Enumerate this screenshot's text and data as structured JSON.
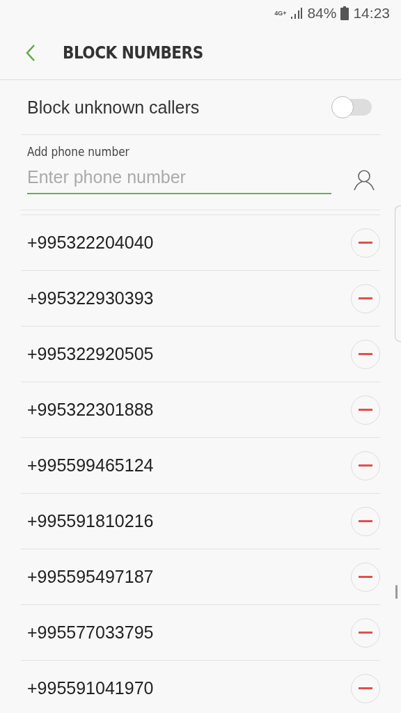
{
  "status_bar": {
    "network": "4G+",
    "battery": "84%",
    "time": "14:23"
  },
  "header": {
    "title": "BLOCK NUMBERS"
  },
  "block_unknown": {
    "label": "Block unknown callers",
    "on": false
  },
  "add_number": {
    "label": "Add phone number",
    "placeholder": "Enter phone number"
  },
  "numbers": [
    {
      "number": "+995322204040"
    },
    {
      "number": "+995322930393"
    },
    {
      "number": "+995322920505"
    },
    {
      "number": "+995322301888"
    },
    {
      "number": "+995599465124"
    },
    {
      "number": "+995591810216"
    },
    {
      "number": "+995595497187"
    },
    {
      "number": "+995577033795"
    },
    {
      "number": "+995591041970"
    }
  ]
}
